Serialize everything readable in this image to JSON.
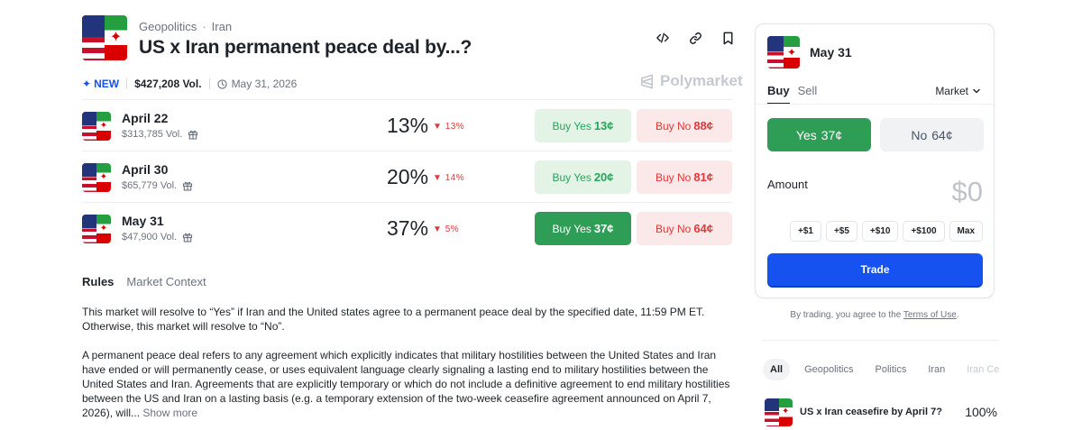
{
  "header": {
    "category": "Geopolitics",
    "subcategory": "Iran",
    "title": "US x Iran permanent peace deal by...?",
    "badge": "NEW",
    "volume": "$427,208 Vol.",
    "end_date": "May 31, 2026",
    "brand": "Polymarket"
  },
  "icons": {
    "embed": "code-icon",
    "link": "link-icon",
    "bookmark": "bookmark-icon",
    "gift": "gift-icon",
    "clock": "clock-icon",
    "down_arrow": "triangle-down-icon"
  },
  "colors": {
    "accent_blue": "#1652f0",
    "yes_green": "#2e9e56",
    "yes_bg": "#e3f4e7",
    "no_red": "#e23838",
    "no_bg": "#fbe9e9"
  },
  "markets": [
    {
      "name": "April 22",
      "volume": "$313,785 Vol.",
      "percent": "13%",
      "change": "13%",
      "yes_label": "Buy Yes",
      "yes_price": "13¢",
      "no_label": "Buy No",
      "no_price": "88¢",
      "selected": false
    },
    {
      "name": "April 30",
      "volume": "$65,779 Vol.",
      "percent": "20%",
      "change": "14%",
      "yes_label": "Buy Yes",
      "yes_price": "20¢",
      "no_label": "Buy No",
      "no_price": "81¢",
      "selected": false
    },
    {
      "name": "May 31",
      "volume": "$47,900 Vol.",
      "percent": "37%",
      "change": "5%",
      "yes_label": "Buy Yes",
      "yes_price": "37¢",
      "no_label": "Buy No",
      "no_price": "64¢",
      "selected": true
    }
  ],
  "rules": {
    "tab_rules": "Rules",
    "tab_context": "Market Context",
    "paragraph1": "This market will resolve to “Yes” if Iran and the United states agree to a permanent peace deal by the specified date, 11:59 PM ET. Otherwise, this market will resolve to “No”.",
    "paragraph2": "A permanent peace deal refers to any agreement which explicitly indicates that military hostilities between the United States and Iran have ended or will permanently cease, or uses equivalent language clearly signaling a lasting end to military hostilities between the United States and Iran. Agreements that are explicitly temporary or which do not include a definitive agreement to end military hostilities between the US and Iran on a lasting basis (e.g. a temporary extension of the two-week ceasefire agreement announced on April 7, 2026), will...",
    "show_more": "Show more"
  },
  "trade_panel": {
    "market": "May 31",
    "buy": "Buy",
    "sell": "Sell",
    "order_type": "Market",
    "yes_label": "Yes",
    "yes_price": "37¢",
    "no_label": "No",
    "no_price": "64¢",
    "amount_label": "Amount",
    "amount_value": "$0",
    "chips": [
      "+$1",
      "+$5",
      "+$10",
      "+$100",
      "Max"
    ],
    "trade_button": "Trade"
  },
  "terms": {
    "prefix": "By trading, you agree to the",
    "link": "Terms of Use",
    "suffix": "."
  },
  "categories": [
    "All",
    "Geopolitics",
    "Politics",
    "Iran",
    "Iran Ce"
  ],
  "related": {
    "title": "US x Iran ceasefire by April 7?",
    "percent": "100%"
  }
}
